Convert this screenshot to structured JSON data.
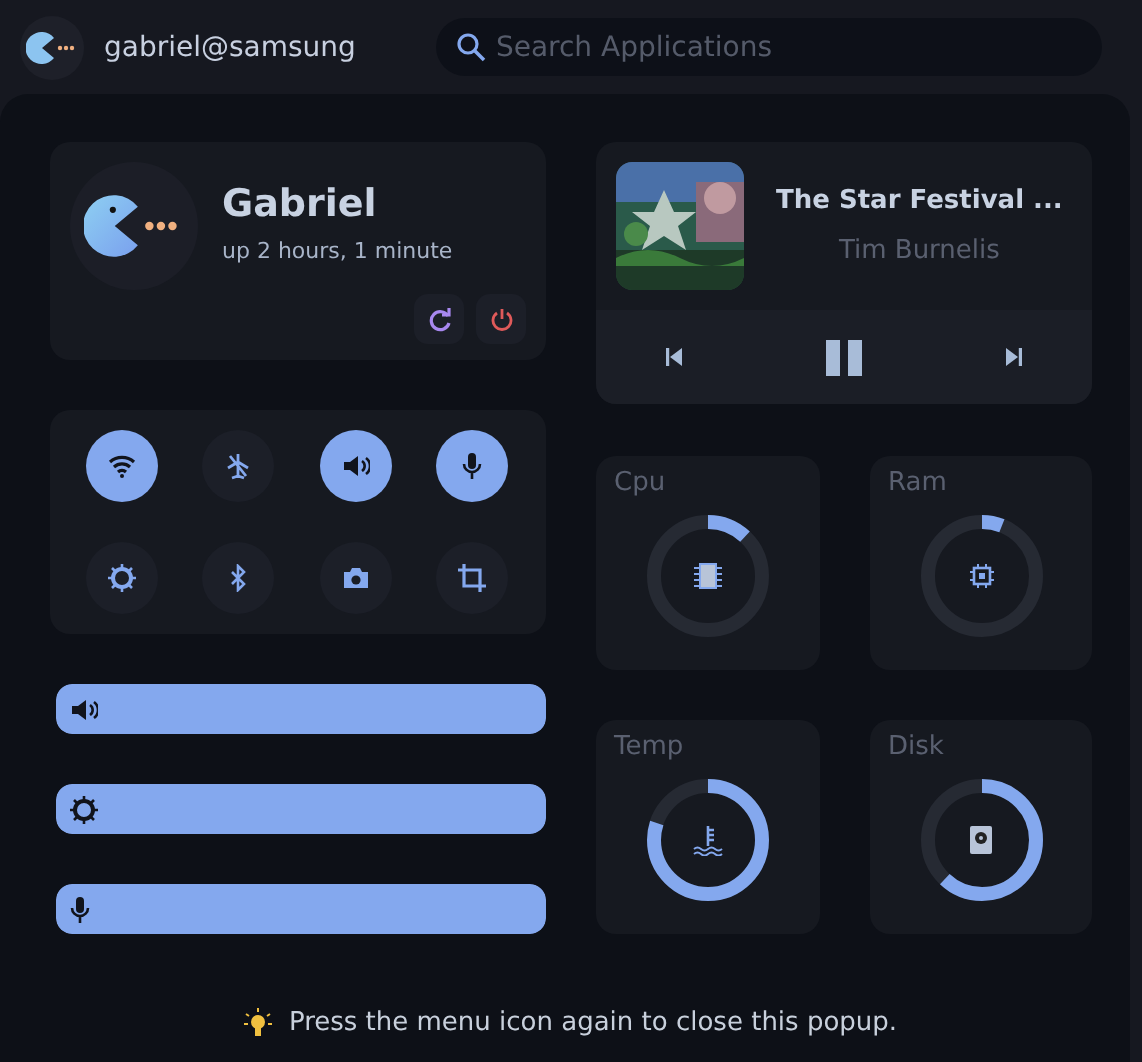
{
  "top_bar": {
    "user": "gabriel@samsung",
    "search": {
      "placeholder": "Search Applications"
    }
  },
  "profile": {
    "name": "Gabriel",
    "uptime": "up 2 hours, 1 minute"
  },
  "toggles": [
    {
      "kind": "wifi",
      "on": true
    },
    {
      "kind": "airplane",
      "on": false
    },
    {
      "kind": "volume",
      "on": true
    },
    {
      "kind": "mic",
      "on": true
    },
    {
      "kind": "brightness",
      "on": false
    },
    {
      "kind": "bluetooth",
      "on": false
    },
    {
      "kind": "camera",
      "on": false
    },
    {
      "kind": "crop",
      "on": false
    }
  ],
  "sliders": [
    {
      "kind": "volume",
      "level": 1
    },
    {
      "kind": "brightness",
      "level": 1
    },
    {
      "kind": "mic",
      "level": 1
    }
  ],
  "media": {
    "title": "The Star Festival  ...",
    "artist": "Tim Burnelis",
    "playing": true
  },
  "gauges": [
    {
      "kind": "cpu",
      "label": "Cpu"
    },
    {
      "kind": "ram",
      "label": "Ram"
    },
    {
      "kind": "temp",
      "label": "Temp"
    },
    {
      "kind": "disk",
      "label": "Disk"
    }
  ],
  "hint": "Press the menu icon again to close this popup."
}
